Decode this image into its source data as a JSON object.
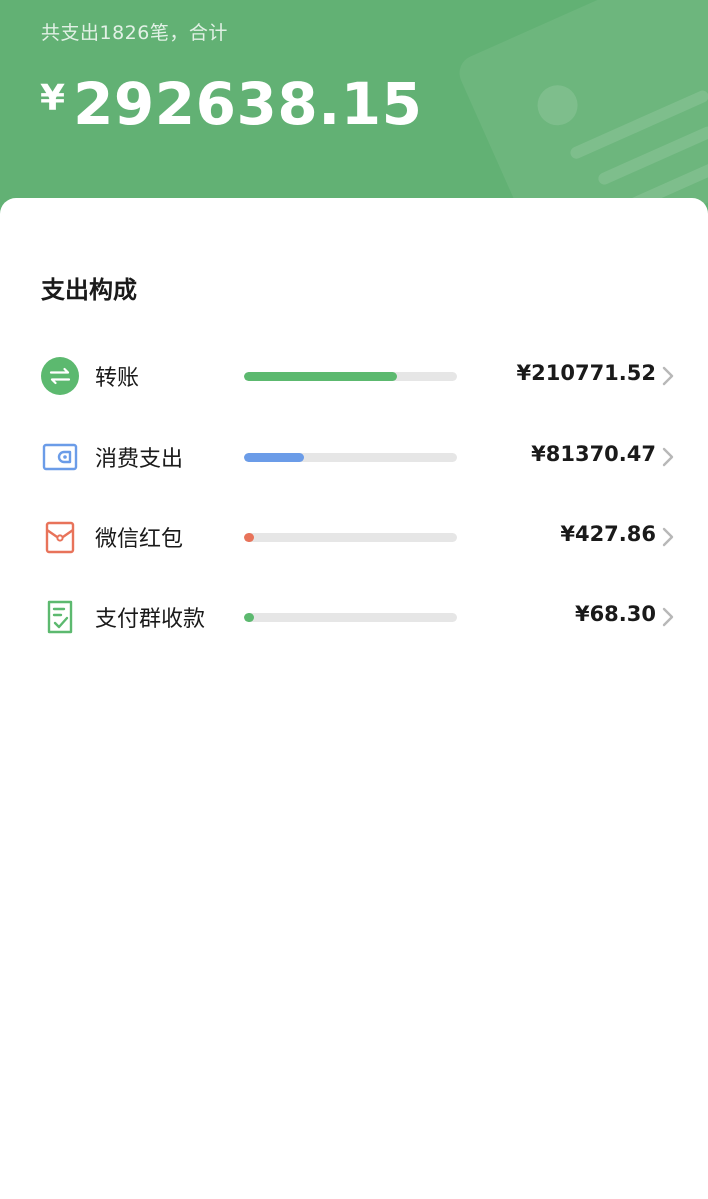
{
  "header": {
    "summary": "共支出1826笔，合计",
    "currency_symbol": "¥",
    "total_amount": "292638.15"
  },
  "section": {
    "title": "支出构成"
  },
  "rows": [
    {
      "label": "转账",
      "value": "¥210771.52",
      "share": 0.72,
      "color": "#5cb96f",
      "icon": "transfer-icon"
    },
    {
      "label": "消费支出",
      "value": "¥81370.47",
      "share": 0.28,
      "color": "#6b9ce8",
      "icon": "wallet-icon"
    },
    {
      "label": "微信红包",
      "value": "¥427.86",
      "share": 0.0015,
      "color": "#e8735a",
      "icon": "red-packet-icon"
    },
    {
      "label": "支付群收款",
      "value": "¥68.30",
      "share": 0.0002,
      "color": "#5cb96f",
      "icon": "group-collect-icon"
    }
  ]
}
